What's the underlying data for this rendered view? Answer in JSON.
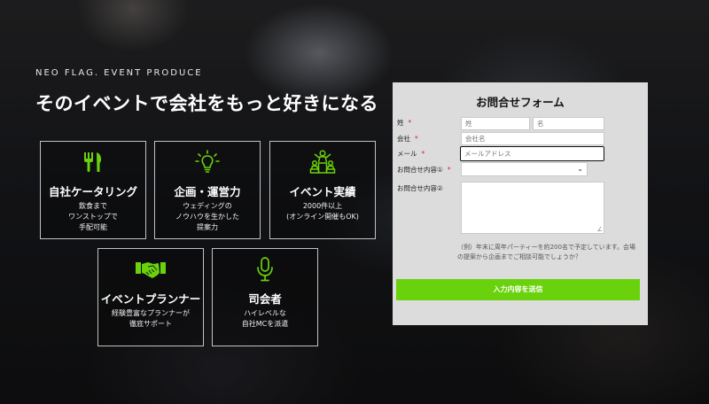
{
  "brand": "NEO FLAG. EVENT PRODUCE",
  "headline": "そのイベントで会社をもっと好きになる",
  "accent_color": "#69d20c",
  "services": [
    {
      "icon": "cutlery-icon",
      "title": "自社ケータリング",
      "desc": [
        "飲食まで",
        "ワンストップで",
        "手配可能"
      ]
    },
    {
      "icon": "lightbulb-icon",
      "title": "企画・運営力",
      "desc": [
        "ウェディングの",
        "ノウハウを生かした",
        "提案力"
      ]
    },
    {
      "icon": "podium-people-icon",
      "title": "イベント実績",
      "desc": [
        "2000件以上",
        "(オンライン開催もOK)"
      ]
    },
    {
      "icon": "handshake-icon",
      "title": "イベントプランナー",
      "desc": [
        "経験豊富なプランナーが",
        "徹底サポート"
      ]
    },
    {
      "icon": "microphone-icon",
      "title": "司会者",
      "desc": [
        "ハイレベルな",
        "自社MCを派遣"
      ]
    }
  ],
  "form": {
    "title": "お問合せフォーム",
    "name_label": "姓",
    "last_name_placeholder": "姓",
    "first_name_placeholder": "名",
    "company_label": "会社",
    "company_placeholder": "会社名",
    "email_label": "メール",
    "email_placeholder": "メールアドレス",
    "inquiry1_label": "お問合せ内容①",
    "inquiry2_label": "お問合せ内容②",
    "required_mark": "*",
    "note": [
      "（例）年末に周年パーティーを約200名で予定しています。会場",
      "の提案から企画までご相談可能でしょうか？"
    ],
    "submit_label": "入力内容を送信"
  }
}
